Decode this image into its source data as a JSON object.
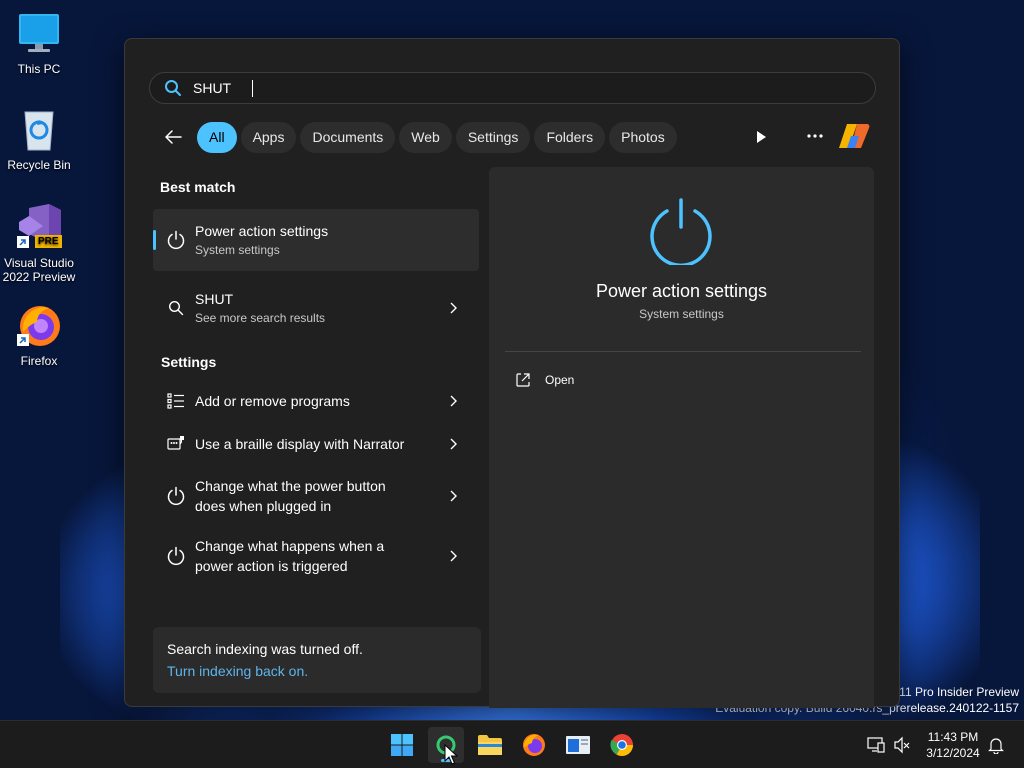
{
  "desktop": {
    "icons": [
      {
        "label": "This PC"
      },
      {
        "label": "Recycle Bin"
      },
      {
        "label_line1": "Visual Studio",
        "label_line2": "2022 Preview",
        "badge": "PRE"
      },
      {
        "label": "Firefox"
      }
    ],
    "watermark": {
      "line1": "s 11 Pro Insider Preview",
      "line2": "Evaluation copy. Build 26040.rs_prerelease.240122-1157"
    }
  },
  "search": {
    "query": "SHUT",
    "filters": [
      "All",
      "Apps",
      "Documents",
      "Web",
      "Settings",
      "Folders",
      "Photos"
    ],
    "active_filter": "All"
  },
  "results": {
    "best_match_title": "Best match",
    "best_match": {
      "title": "Power action settings",
      "subtitle": "System settings"
    },
    "web_item": {
      "title": "SHUT",
      "subtitle": "See more search results"
    },
    "settings_title": "Settings",
    "settings_items": [
      {
        "title": "Add or remove programs"
      },
      {
        "title": "Use a braille display with Narrator"
      },
      {
        "line1": "Change what the power button",
        "line2": "does when plugged in"
      },
      {
        "line1": "Change what happens when a",
        "line2": "power action is triggered"
      }
    ]
  },
  "indexing": {
    "message": "Search indexing was turned off.",
    "link": "Turn indexing back on."
  },
  "preview": {
    "title": "Power action settings",
    "subtitle": "System settings",
    "action_open": "Open"
  },
  "taskbar": {
    "time": "11:43 PM",
    "date": "3/12/2024"
  },
  "colors": {
    "accent": "#4cc2ff",
    "link": "#60b4ec",
    "panel_bg": "#202020",
    "preview_bg": "#2b2b2b"
  }
}
